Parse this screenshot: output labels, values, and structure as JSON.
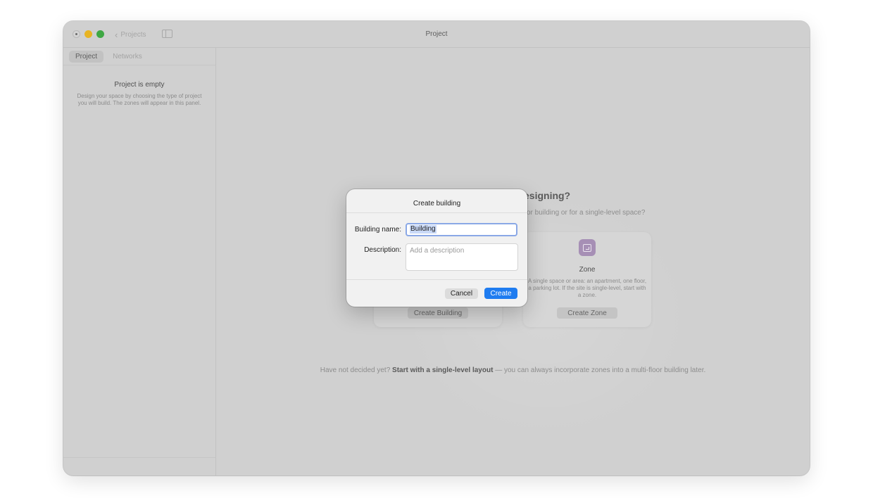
{
  "window": {
    "title": "Project",
    "back_label": "Projects"
  },
  "sidebar": {
    "tabs": [
      {
        "label": "Project",
        "active": true
      },
      {
        "label": "Networks",
        "active": false
      }
    ],
    "empty_title": "Project is empty",
    "empty_description": "Design your space by choosing the type of project you will build. The zones will appear in this panel."
  },
  "main": {
    "heading_visible": "esigning?",
    "subheading_visible": "or building or for a single-level space?",
    "cards": {
      "building": {
        "button": "Create Building"
      },
      "zone": {
        "title": "Zone",
        "description": "A single space or area: an apartment, one floor, a parking lot. If the site is single-level, start with a zone.",
        "button": "Create Zone"
      }
    },
    "footer": {
      "prefix": "Have not decided yet?",
      "link": "Start with a single-level layout",
      "suffix": "— you can always incorporate zones into a multi-floor building later."
    }
  },
  "dialog": {
    "title": "Create building",
    "name_label": "Building name:",
    "name_value": "Building",
    "description_label": "Description:",
    "description_placeholder": "Add a description",
    "cancel_label": "Cancel",
    "create_label": "Create"
  },
  "colors": {
    "accent": "#1f7cf0",
    "zone_icon": "#a68fb5"
  },
  "icons": [
    "chevron-left-icon",
    "sidebar-toggle-icon",
    "zone-icon"
  ]
}
